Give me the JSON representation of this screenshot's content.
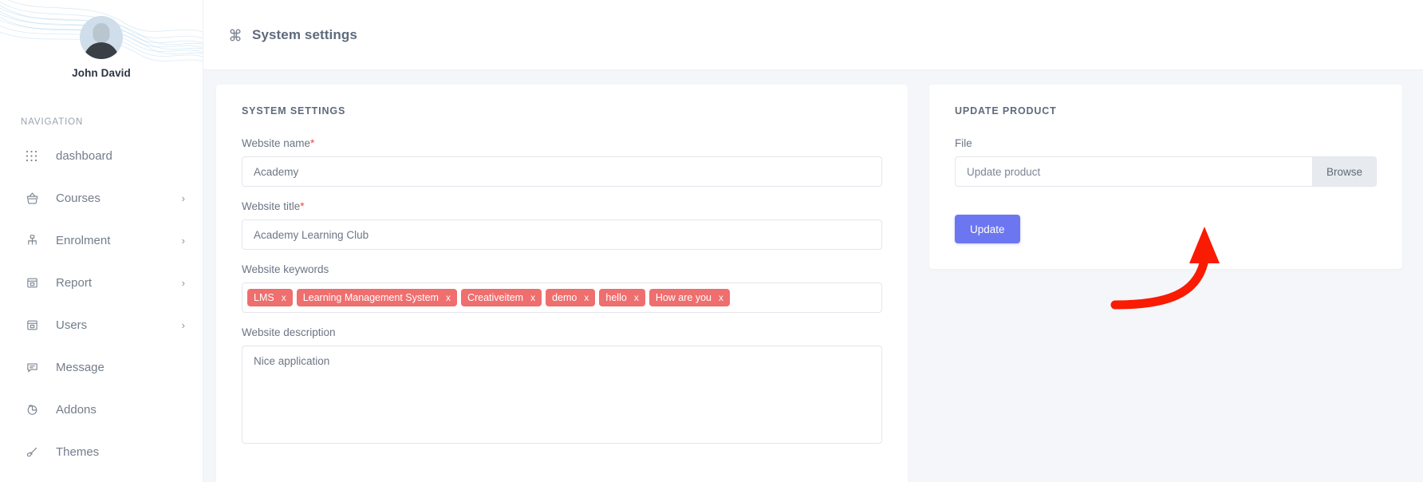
{
  "sidebar": {
    "profile": {
      "name": "John David",
      "avatar_icon": "user-avatar"
    },
    "nav_heading": "NAVIGATION",
    "items": [
      {
        "label": "dashboard",
        "icon": "grid-dots-icon",
        "has_caret": false
      },
      {
        "label": "Courses",
        "icon": "basket-icon",
        "has_caret": true,
        "caret": "›"
      },
      {
        "label": "Enrolment",
        "icon": "sitemap-icon",
        "has_caret": true,
        "caret": "›"
      },
      {
        "label": "Report",
        "icon": "archive-box-icon",
        "has_caret": true,
        "caret": "›"
      },
      {
        "label": "Users",
        "icon": "archive-box-icon",
        "has_caret": true,
        "caret": "›"
      },
      {
        "label": "Message",
        "icon": "chat-bubble-icon",
        "has_caret": false
      },
      {
        "label": "Addons",
        "icon": "pie-chart-icon",
        "has_caret": false
      },
      {
        "label": "Themes",
        "icon": "brush-icon",
        "has_caret": false
      }
    ]
  },
  "header": {
    "icon": "command-icon",
    "title": "System settings"
  },
  "system_settings": {
    "card_title": "SYSTEM SETTINGS",
    "website_name": {
      "label": "Website name",
      "required_marker": "*",
      "value": "Academy"
    },
    "website_title": {
      "label": "Website title",
      "required_marker": "*",
      "value": "Academy Learning Club"
    },
    "website_keywords": {
      "label": "Website keywords",
      "remove_glyph": "x",
      "tags": [
        "LMS",
        "Learning Management System",
        "Creativeitem",
        "demo",
        "hello",
        "How are you"
      ]
    },
    "website_description": {
      "label": "Website description",
      "value": "Nice application"
    }
  },
  "update_product": {
    "card_title": "UPDATE PRODUCT",
    "file_label": "File",
    "file_placeholder": "Update product",
    "browse_label": "Browse",
    "update_label": "Update"
  },
  "annotation": {
    "arrow_color": "#f91b02",
    "points_to": "update-button"
  },
  "colors": {
    "accent": "#6c76f0",
    "tag": "#ef6e6e",
    "required": "#f0493e",
    "page_bg": "#f4f6f9",
    "card_bg": "#ffffff",
    "text_muted": "#6b7584"
  }
}
